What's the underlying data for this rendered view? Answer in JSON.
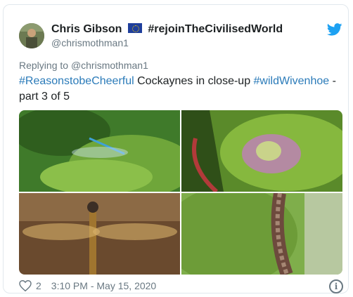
{
  "tweet": {
    "author_name": "Chris Gibson",
    "author_name_suffix": "#rejoinTheCivilisedWorld",
    "author_handle": "@chrismothman1",
    "reply_to_prefix": "Replying to",
    "reply_to_handle": "@chrismothman1",
    "text_parts": [
      {
        "text": "#ReasonstobeCheerful",
        "hashtag": true
      },
      {
        "text": " Cockaynes in close-up ",
        "hashtag": false
      },
      {
        "text": "#wildWivenhoe",
        "hashtag": true
      },
      {
        "text": " -",
        "hashtag": false
      },
      {
        "text": "part 3 of 5",
        "hashtag": false
      }
    ],
    "likes": "2",
    "timestamp": "3:10 PM - May 15, 2020",
    "media": [
      "damselfly-photo",
      "shieldbug-photo",
      "dragonfly-photo",
      "caterpillar-photo"
    ]
  },
  "icons": {
    "brand": "twitter-icon",
    "flag": "eu-flag-icon",
    "like": "heart-icon",
    "info": "info-icon"
  },
  "colors": {
    "hashtag": "#2b7bb9",
    "twitter_blue": "#1da1f2",
    "muted": "#697882"
  }
}
